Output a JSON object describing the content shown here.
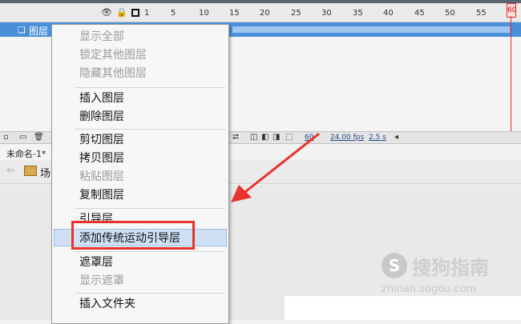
{
  "timeline": {
    "ruler": [
      "1",
      "5",
      "10",
      "15",
      "20",
      "25",
      "30",
      "35",
      "40",
      "45",
      "50",
      "55",
      "60"
    ],
    "layer_name": "图层",
    "playhead_frame": "60",
    "footer": {
      "frame": "60",
      "fps": "24.00 fps",
      "time": "2.5 s"
    }
  },
  "document": {
    "tab": "未命名-1*",
    "scene": "场"
  },
  "menu": {
    "items": [
      {
        "label": "显示全部",
        "disabled": true
      },
      {
        "label": "锁定其他图层",
        "disabled": true
      },
      {
        "label": "隐藏其他图层",
        "disabled": true
      },
      {
        "label": "插入图层",
        "disabled": false
      },
      {
        "label": "删除图层",
        "disabled": false
      },
      {
        "label": "剪切图层",
        "disabled": false
      },
      {
        "label": "拷贝图层",
        "disabled": false
      },
      {
        "label": "粘贴图层",
        "disabled": true
      },
      {
        "label": "复制图层",
        "disabled": false
      },
      {
        "label": "引导层",
        "disabled": false
      },
      {
        "label": "添加传统运动引导层",
        "disabled": false,
        "highlighted": true
      },
      {
        "label": "遮罩层",
        "disabled": false
      },
      {
        "label": "显示遮罩",
        "disabled": true
      },
      {
        "label": "插入文件夹",
        "disabled": false
      }
    ]
  },
  "watermark": {
    "logo": "S",
    "name": "搜狗指南",
    "url": "zhinan.sogou.com"
  },
  "colors": {
    "layer_selected": "#4a90d9",
    "annotation_red": "#e8332a",
    "menu_highlight": "#cfe0f5"
  }
}
